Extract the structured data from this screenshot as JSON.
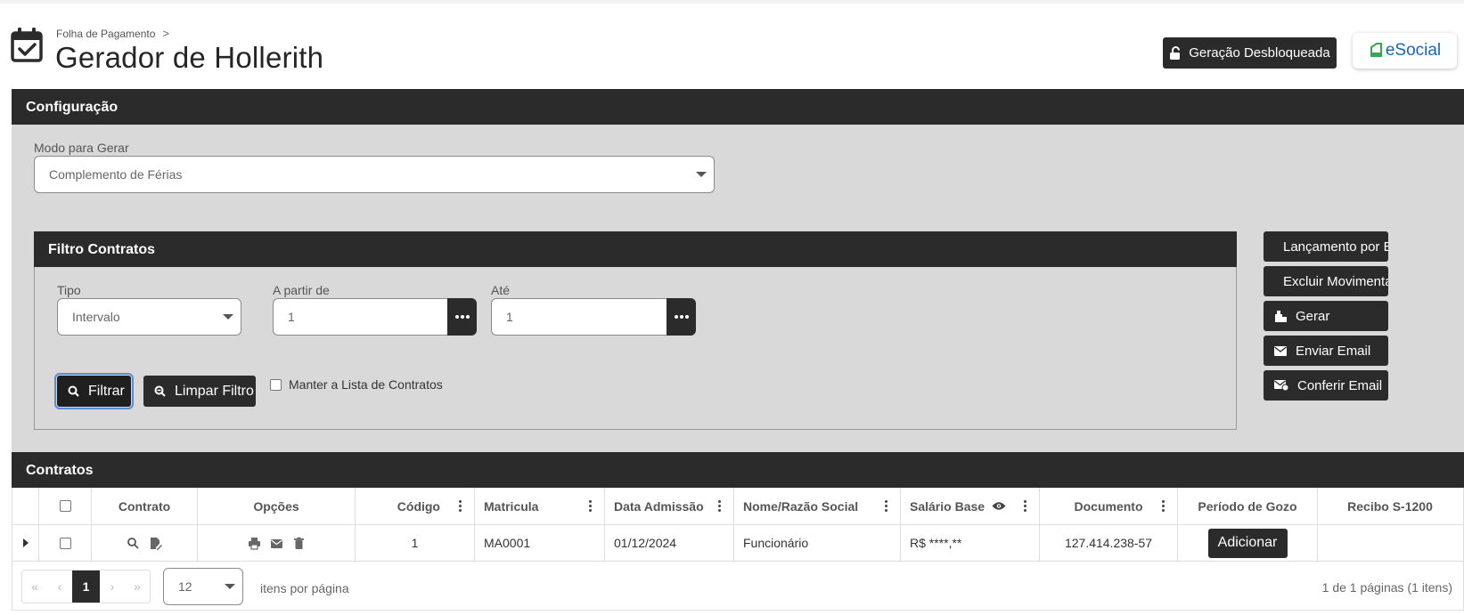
{
  "header": {
    "breadcrumb": "Folha de Pagamento",
    "breadcrumb_separator": ">",
    "title": "Gerador de Hollerith",
    "unlock_button": "Geração Desbloqueada",
    "esocial_label": "eSocial"
  },
  "config": {
    "section_title": "Configuração",
    "mode_label": "Modo para Gerar",
    "mode_value": "Complemento de Férias"
  },
  "filter": {
    "section_title": "Filtro Contratos",
    "type_label": "Tipo",
    "type_value": "Intervalo",
    "from_label": "A partir de",
    "from_value": "1",
    "to_label": "Até",
    "to_value": "1",
    "filter_button": "Filtrar",
    "clear_button": "Limpar Filtro",
    "keep_list_label": "Manter a Lista de Contratos"
  },
  "actions": [
    {
      "label": "Lançamento por Evento",
      "icon": "table-icon"
    },
    {
      "label": "Excluir Movimentação",
      "icon": "trash-icon"
    },
    {
      "label": "Gerar",
      "icon": "generate-icon"
    },
    {
      "label": "Enviar Email",
      "icon": "envelope-icon"
    },
    {
      "label": "Conferir Email",
      "icon": "envelope-check-icon"
    }
  ],
  "contracts": {
    "section_title": "Contratos",
    "columns": [
      "Contrato",
      "Opções",
      "Código",
      "Matricula",
      "Data Admissão",
      "Nome/Razão Social",
      "Salário Base",
      "Documento",
      "Período de Gozo",
      "Recibo S-1200"
    ],
    "rows": [
      {
        "codigo": "1",
        "matricula": "MA0001",
        "data_admissao": "01/12/2024",
        "nome": "Funcionário",
        "salario": "R$ ****,**",
        "documento": "127.414.238-57",
        "periodo_button": "Adicionar",
        "recibo": ""
      }
    ]
  },
  "pager": {
    "first": "«",
    "prev": "‹",
    "current": "1",
    "next": "›",
    "last": "»",
    "page_size": "12",
    "per_page_label": "itens por página",
    "info": "1 de 1 páginas (1 itens)"
  },
  "colors": {
    "dark": "#2b2b2b",
    "panel": "#d9d9d9",
    "esocial_blue": "#1b64b3",
    "esocial_green": "#3aa655"
  }
}
